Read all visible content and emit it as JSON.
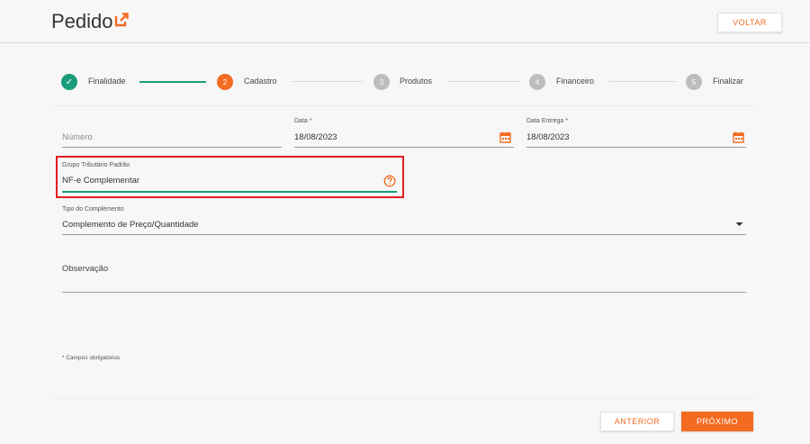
{
  "header": {
    "title": "Pedido",
    "title_icon": "edit-external-icon",
    "back_label": "VOLTAR"
  },
  "stepper": {
    "steps": [
      {
        "number": "✓",
        "label": "Finalidade",
        "state": "done"
      },
      {
        "number": "2",
        "label": "Cadastro",
        "state": "active"
      },
      {
        "number": "3",
        "label": "Produtos",
        "state": "pending"
      },
      {
        "number": "4",
        "label": "Financeiro",
        "state": "pending"
      },
      {
        "number": "5",
        "label": "Finalizar",
        "state": "pending"
      }
    ]
  },
  "form": {
    "numero": {
      "placeholder": "Número",
      "value": ""
    },
    "data": {
      "label": "Data *",
      "value": "18/08/2023"
    },
    "data_entrega": {
      "label": "Data Entrega *",
      "value": "18/08/2023"
    },
    "grupo_tributario": {
      "label": "Grupo Tributário Padrão",
      "value": "NF-e Complementar"
    },
    "tipo_complemento": {
      "label": "Tipo do Complemento",
      "value": "Complemento de Preço/Quantidade"
    },
    "observacao": {
      "placeholder": "Observação",
      "value": ""
    },
    "required_note": "* Campos obrigatórios"
  },
  "footer": {
    "previous_label": "ANTERIOR",
    "next_label": "PRÓXIMO"
  },
  "colors": {
    "accent": "#f26b21",
    "success": "#1a9c7a",
    "highlight": "#e21d24",
    "pending_step": "#bdbdbd"
  }
}
